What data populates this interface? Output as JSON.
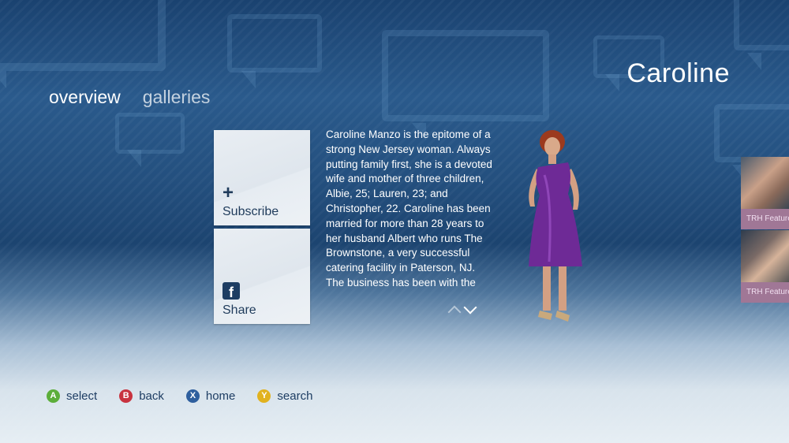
{
  "page": {
    "title": "Caroline"
  },
  "pivot": [
    {
      "label": "overview",
      "active": true
    },
    {
      "label": "galleries",
      "active": false
    }
  ],
  "tiles": {
    "subscribe": {
      "label": "Subscribe",
      "icon": "plus-icon"
    },
    "share": {
      "label": "Share",
      "icon": "facebook-icon"
    }
  },
  "bio": {
    "text": "Caroline Manzo is the epitome of a strong New Jersey woman. Always putting family first, she is a devoted wife and mother of three children, Albie, 25; Lauren, 23; and Christopher, 22. Caroline has been married for more than 28 years to her husband Albert who runs The Brownstone, a very successful catering facility in Paterson, NJ. The business has been with the family"
  },
  "side_items": [
    {
      "label": "TRH Featurette"
    },
    {
      "label": "TRH Featurette"
    }
  ],
  "controller_hints": [
    {
      "key": "A",
      "label": "select",
      "color": "#5cae3a"
    },
    {
      "key": "B",
      "label": "back",
      "color": "#c8333f"
    },
    {
      "key": "X",
      "label": "home",
      "color": "#2e5f9e"
    },
    {
      "key": "Y",
      "label": "search",
      "color": "#e1b21f"
    }
  ]
}
